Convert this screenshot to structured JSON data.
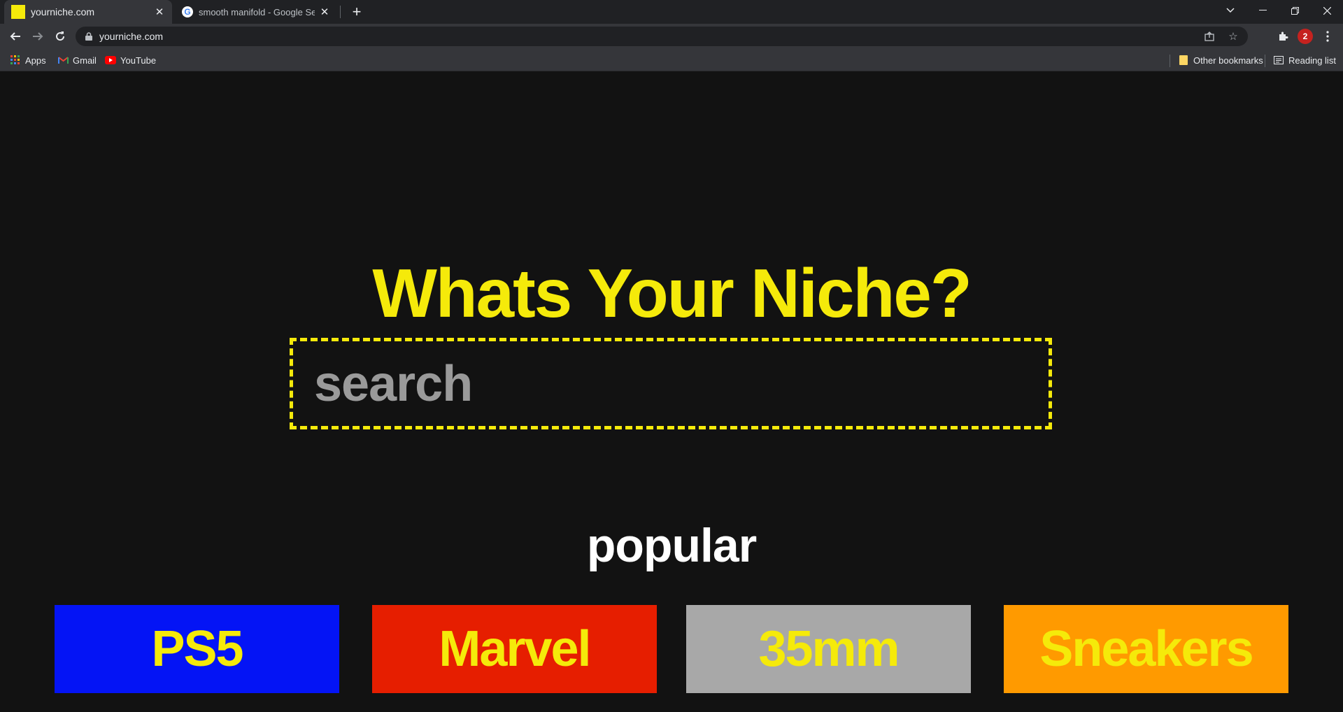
{
  "browser": {
    "tabs": [
      {
        "title": "yourniche.com",
        "active": true
      },
      {
        "title": "smooth manifold - Google Search",
        "active": false
      }
    ],
    "new_tab_symbol": "+",
    "url": "yourniche.com",
    "bookmarks": [
      {
        "label": "Apps",
        "icon": "apps-grid-icon"
      },
      {
        "label": "Gmail",
        "icon": "gmail-icon"
      },
      {
        "label": "YouTube",
        "icon": "youtube-icon"
      }
    ],
    "other_bookmarks": "Other bookmarks",
    "reading_list": "Reading list",
    "profile_initial": "2"
  },
  "page": {
    "heading": "Whats Your Niche?",
    "search": {
      "placeholder": "search",
      "value": ""
    },
    "popular_heading": "popular",
    "categories": [
      {
        "label": "PS5",
        "color": "#0414f5"
      },
      {
        "label": "Marvel",
        "color": "#e61e00"
      },
      {
        "label": "35mm",
        "color": "#a8a8a8"
      },
      {
        "label": "Sneakers",
        "color": "#ff9a00"
      }
    ],
    "accent_color": "#f5ea0a",
    "background_color": "#121212"
  }
}
